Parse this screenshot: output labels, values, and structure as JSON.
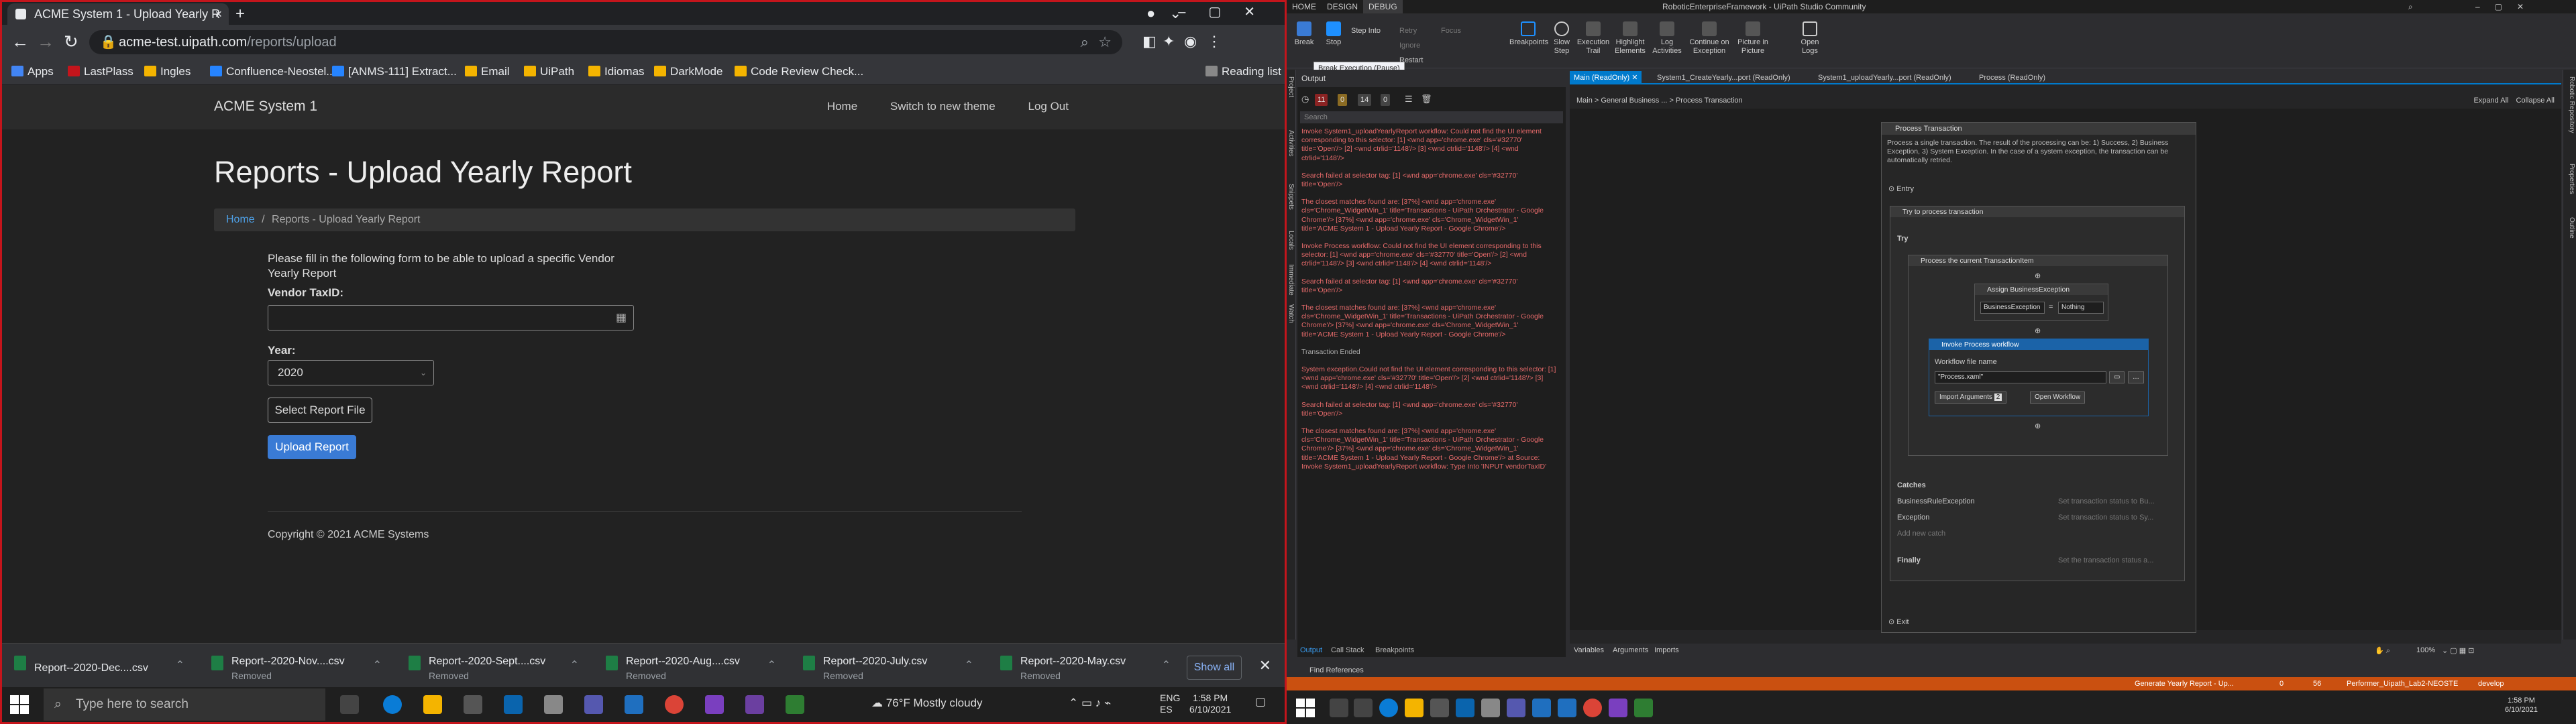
{
  "browser": {
    "tab_title": "ACME System 1 - Upload Yearly R",
    "url_host": "acme-test.uipath.com",
    "url_path": "/reports/upload",
    "bookmarks": [
      "Apps",
      "LastPlass",
      "Ingles",
      "Confluence-Neostel...",
      "[ANMS-111] Extract...",
      "Email",
      "UiPath",
      "Idiomas",
      "DarkMode",
      "Code Review Check..."
    ],
    "reading_list": "Reading list"
  },
  "page": {
    "brand": "ACME System 1",
    "nav": [
      "Home",
      "Switch to new theme",
      "Log Out"
    ],
    "title": "Reports - Upload Yearly Report",
    "breadcrumb_home": "Home",
    "breadcrumb_sep": "/",
    "breadcrumb_current": "Reports - Upload Yearly Report",
    "intro": "Please fill in the following form to be able to upload a specific Vendor Yearly Report",
    "vendor_label": "Vendor TaxID:",
    "vendor_value": "",
    "year_label": "Year:",
    "year_value": "2020",
    "select_button": "Select Report File",
    "upload_button": "Upload Report",
    "copyright": "Copyright © 2021 ACME Systems"
  },
  "downloads": {
    "items": [
      {
        "name": "Report--2020-Dec....csv",
        "status": ""
      },
      {
        "name": "Report--2020-Nov....csv",
        "status": "Removed"
      },
      {
        "name": "Report--2020-Sept....csv",
        "status": "Removed"
      },
      {
        "name": "Report--2020-Aug....csv",
        "status": "Removed"
      },
      {
        "name": "Report--2020-July.csv",
        "status": "Removed"
      },
      {
        "name": "Report--2020-May.csv",
        "status": "Removed"
      }
    ],
    "show_all": "Show all"
  },
  "taskbar": {
    "search_placeholder": "Type here to search",
    "weather": "76°F  Mostly cloudy",
    "lang": "ENG",
    "lang2": "ES",
    "time": "1:58 PM",
    "date": "6/10/2021"
  },
  "studio": {
    "title": "RoboticEnterpriseFramework - UiPath Studio Community",
    "ribbon_tabs": [
      "HOME",
      "DESIGN",
      "DEBUG"
    ],
    "ribbon_buttons": [
      "Break",
      "Stop",
      "Step Into",
      "Retry",
      "Ignore",
      "Restart",
      "Focus",
      "Breakpoints",
      "Slow Step",
      "Execution Trail",
      "Highlight Elements",
      "Log Activities",
      "Continue on Exception",
      "Picture in Picture",
      "Open Logs"
    ],
    "tooltip": "Break Execution (Pause)",
    "left_panels": [
      "Project",
      "Activities",
      "Snippets",
      "Locals",
      "Immediate",
      "Watch"
    ],
    "output_title": "Output",
    "output_counts": [
      "11",
      "0",
      "14",
      "0"
    ],
    "output_search": "Search",
    "log": [
      "Invoke System1_uploadYearlyReport workflow: Could not find the UI element corresponding to this selector: [1] <wnd app='chrome.exe' cls='#32770' title='Open'/> [2] <wnd ctrlid='1148'/> [3] <wnd ctrlid='1148'/> [4] <wnd ctrlid='1148'/>",
      "Search failed at selector tag: [1] <wnd app='chrome.exe' cls='#32770' title='Open'/>",
      "The closest matches found are: [37%] <wnd app='chrome.exe' cls='Chrome_WidgetWin_1' title='Transactions - UiPath Orchestrator - Google Chrome'/> [37%] <wnd app='chrome.exe' cls='Chrome_WidgetWin_1' title='ACME System 1 - Upload Yearly Report - Google Chrome'/>",
      "Invoke Process workflow: Could not find the UI element corresponding to this selector: [1] <wnd app='chrome.exe' cls='#32770' title='Open'/> [2] <wnd ctrlid='1148'/> [3] <wnd ctrlid='1148'/> [4] <wnd ctrlid='1148'/>",
      "Search failed at selector tag: [1] <wnd app='chrome.exe' cls='#32770' title='Open'/>",
      "The closest matches found are: [37%] <wnd app='chrome.exe' cls='Chrome_WidgetWin_1' title='Transactions - UiPath Orchestrator - Google Chrome'/> [37%] <wnd app='chrome.exe' cls='Chrome_WidgetWin_1' title='ACME System 1 - Upload Yearly Report - Google Chrome'/>",
      "Transaction Ended",
      "System exception.Could not find the UI element corresponding to this selector: [1] <wnd app='chrome.exe' cls='#32770' title='Open'/> [2] <wnd ctrlid='1148'/> [3] <wnd ctrlid='1148'/> [4] <wnd ctrlid='1148'/>",
      "Search failed at selector tag: [1] <wnd app='chrome.exe' cls='#32770' title='Open'/>",
      "The closest matches found are: [37%] <wnd app='chrome.exe' cls='Chrome_WidgetWin_1' title='Transactions - UiPath Orchestrator - Google Chrome'/> [37%] <wnd app='chrome.exe' cls='Chrome_WidgetWin_1' title='ACME System 1 - Upload Yearly Report - Google Chrome'/> at Source: Invoke System1_uploadYearlyReport workflow: Type Into 'INPUT  vendorTaxID'"
    ],
    "output_bottom_tabs": [
      "Output",
      "Call Stack",
      "Breakpoints"
    ],
    "find_references": "Find References",
    "doc_tabs": [
      "Main (ReadOnly)",
      "System1_CreateYearly...port (ReadOnly)",
      "System1_uploadYearly...port (ReadOnly)",
      "Process (ReadOnly)"
    ],
    "breadcrumb": "Main  >  General Business ...  >  Process Transaction",
    "expand_all": "Expand All",
    "collapse_all": "Collapse All",
    "seq_title": "Process Transaction",
    "seq_desc": "Process a single transaction. The result of the processing can be: 1) Success, 2) Business Exception, 3) System Exception. In the case of a system exception, the transaction can be automatically retried.",
    "entry": "Entry",
    "try_catch": "Try to process transaction",
    "try": "Try",
    "process_current": "Process the current TransactionItem",
    "assign": "Assign BusinessException",
    "assign_left": "BusinessException",
    "assign_eq": "=",
    "assign_right": "Nothing",
    "invoke": "Invoke Process workflow",
    "wf_label": "Workflow file name",
    "wf_value": "\"Process.xaml\"",
    "import_args": "Import Arguments",
    "import_count": "2",
    "open_wf": "Open Workflow",
    "catches": "Catches",
    "catch1": "BusinessRuleException",
    "catch1_val": "Set transaction status to Bu...",
    "catch2": "Exception",
    "catch2_val": "Set transaction status to Sy...",
    "add_catch": "Add new catch",
    "finally": "Finally",
    "finally_val": "Set the transaction status a...",
    "exit": "Exit",
    "footer_tabs": [
      "Variables",
      "Arguments",
      "Imports"
    ],
    "zoom": "100%",
    "right_panels": [
      "Robotic Repository",
      "Properties",
      "Outline"
    ],
    "status_mid": "Generate Yearly Report - Up...",
    "status_right": "Performer_Uipath_Lab2-NEOSTE",
    "status_branch": "develop",
    "status_count": "56",
    "status_zero": "0",
    "time": "1:58 PM",
    "date": "6/10/2021"
  },
  "colors": {
    "accent": "#007acc",
    "status": "#ca5010",
    "error": "#e56a6a",
    "link": "#4ea1e8",
    "primary": "#3a7bd5",
    "border": "#c4151c"
  }
}
